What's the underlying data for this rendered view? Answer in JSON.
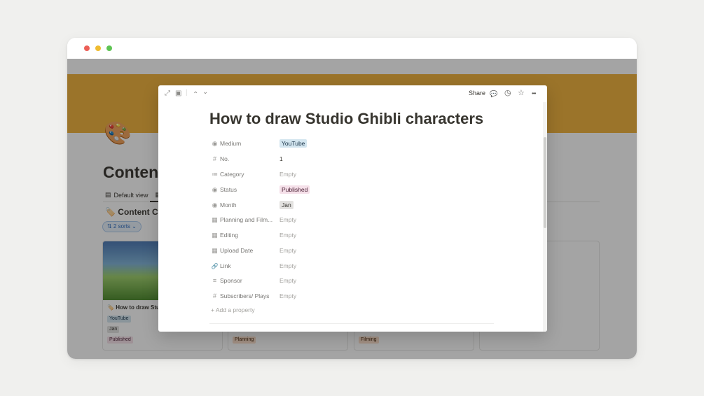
{
  "window": {
    "title_dots": [
      "close",
      "minimize",
      "maximize"
    ]
  },
  "background_page": {
    "page_icon": "🎨",
    "db_title": "Content",
    "views": [
      {
        "label": "Default view",
        "icon": "table-icon"
      }
    ],
    "section_title": "Content Ca",
    "section_icon": "🏷️",
    "sorts_label": "⇅ 2 sorts ⌄",
    "cards": [
      {
        "title": "How to draw Stu",
        "icon": "🏷️",
        "tags": [
          {
            "label": "YouTube",
            "color": "blue"
          },
          {
            "label": "Jan",
            "color": "gray"
          },
          {
            "label": "Published",
            "color": "pink"
          }
        ]
      },
      {
        "tags": [
          {
            "label": "Planning",
            "color": "orange"
          }
        ]
      },
      {
        "tags": [
          {
            "label": "Filming",
            "color": "orange"
          }
        ]
      }
    ]
  },
  "modal": {
    "toolbar": {
      "expand_icon": "⤢",
      "peek_icon": "▣",
      "prev_icon": "⌃",
      "next_icon": "⌄",
      "share_label": "Share",
      "comment_icon": "💬",
      "history_icon": "◷",
      "favorite_icon": "☆",
      "more_icon": "•••"
    },
    "title": "How to draw Studio Ghibli characters",
    "properties": [
      {
        "name": "Medium",
        "icon": "◉",
        "value": "YouTube",
        "style": "chip-blue"
      },
      {
        "name": "No.",
        "icon": "#",
        "value": "1",
        "style": "plain"
      },
      {
        "name": "Category",
        "icon": "≔",
        "value": "Empty",
        "style": "empty"
      },
      {
        "name": "Status",
        "icon": "◉",
        "value": "Published",
        "style": "chip-pink"
      },
      {
        "name": "Month",
        "icon": "◉",
        "value": "Jan",
        "style": "chip-gray"
      },
      {
        "name": "Planning and Film...",
        "icon": "▦",
        "value": "Empty",
        "style": "empty"
      },
      {
        "name": "Editing",
        "icon": "▦",
        "value": "Empty",
        "style": "empty"
      },
      {
        "name": "Upload Date",
        "icon": "▦",
        "value": "Empty",
        "style": "empty"
      },
      {
        "name": "Link",
        "icon": "🔗",
        "value": "Empty",
        "style": "empty"
      },
      {
        "name": "Sponsor",
        "icon": "≡",
        "value": "Empty",
        "style": "empty"
      },
      {
        "name": "Subscribers/ Plays",
        "icon": "#",
        "value": "Empty",
        "style": "empty"
      }
    ],
    "add_property_label": "+   Add a property"
  }
}
